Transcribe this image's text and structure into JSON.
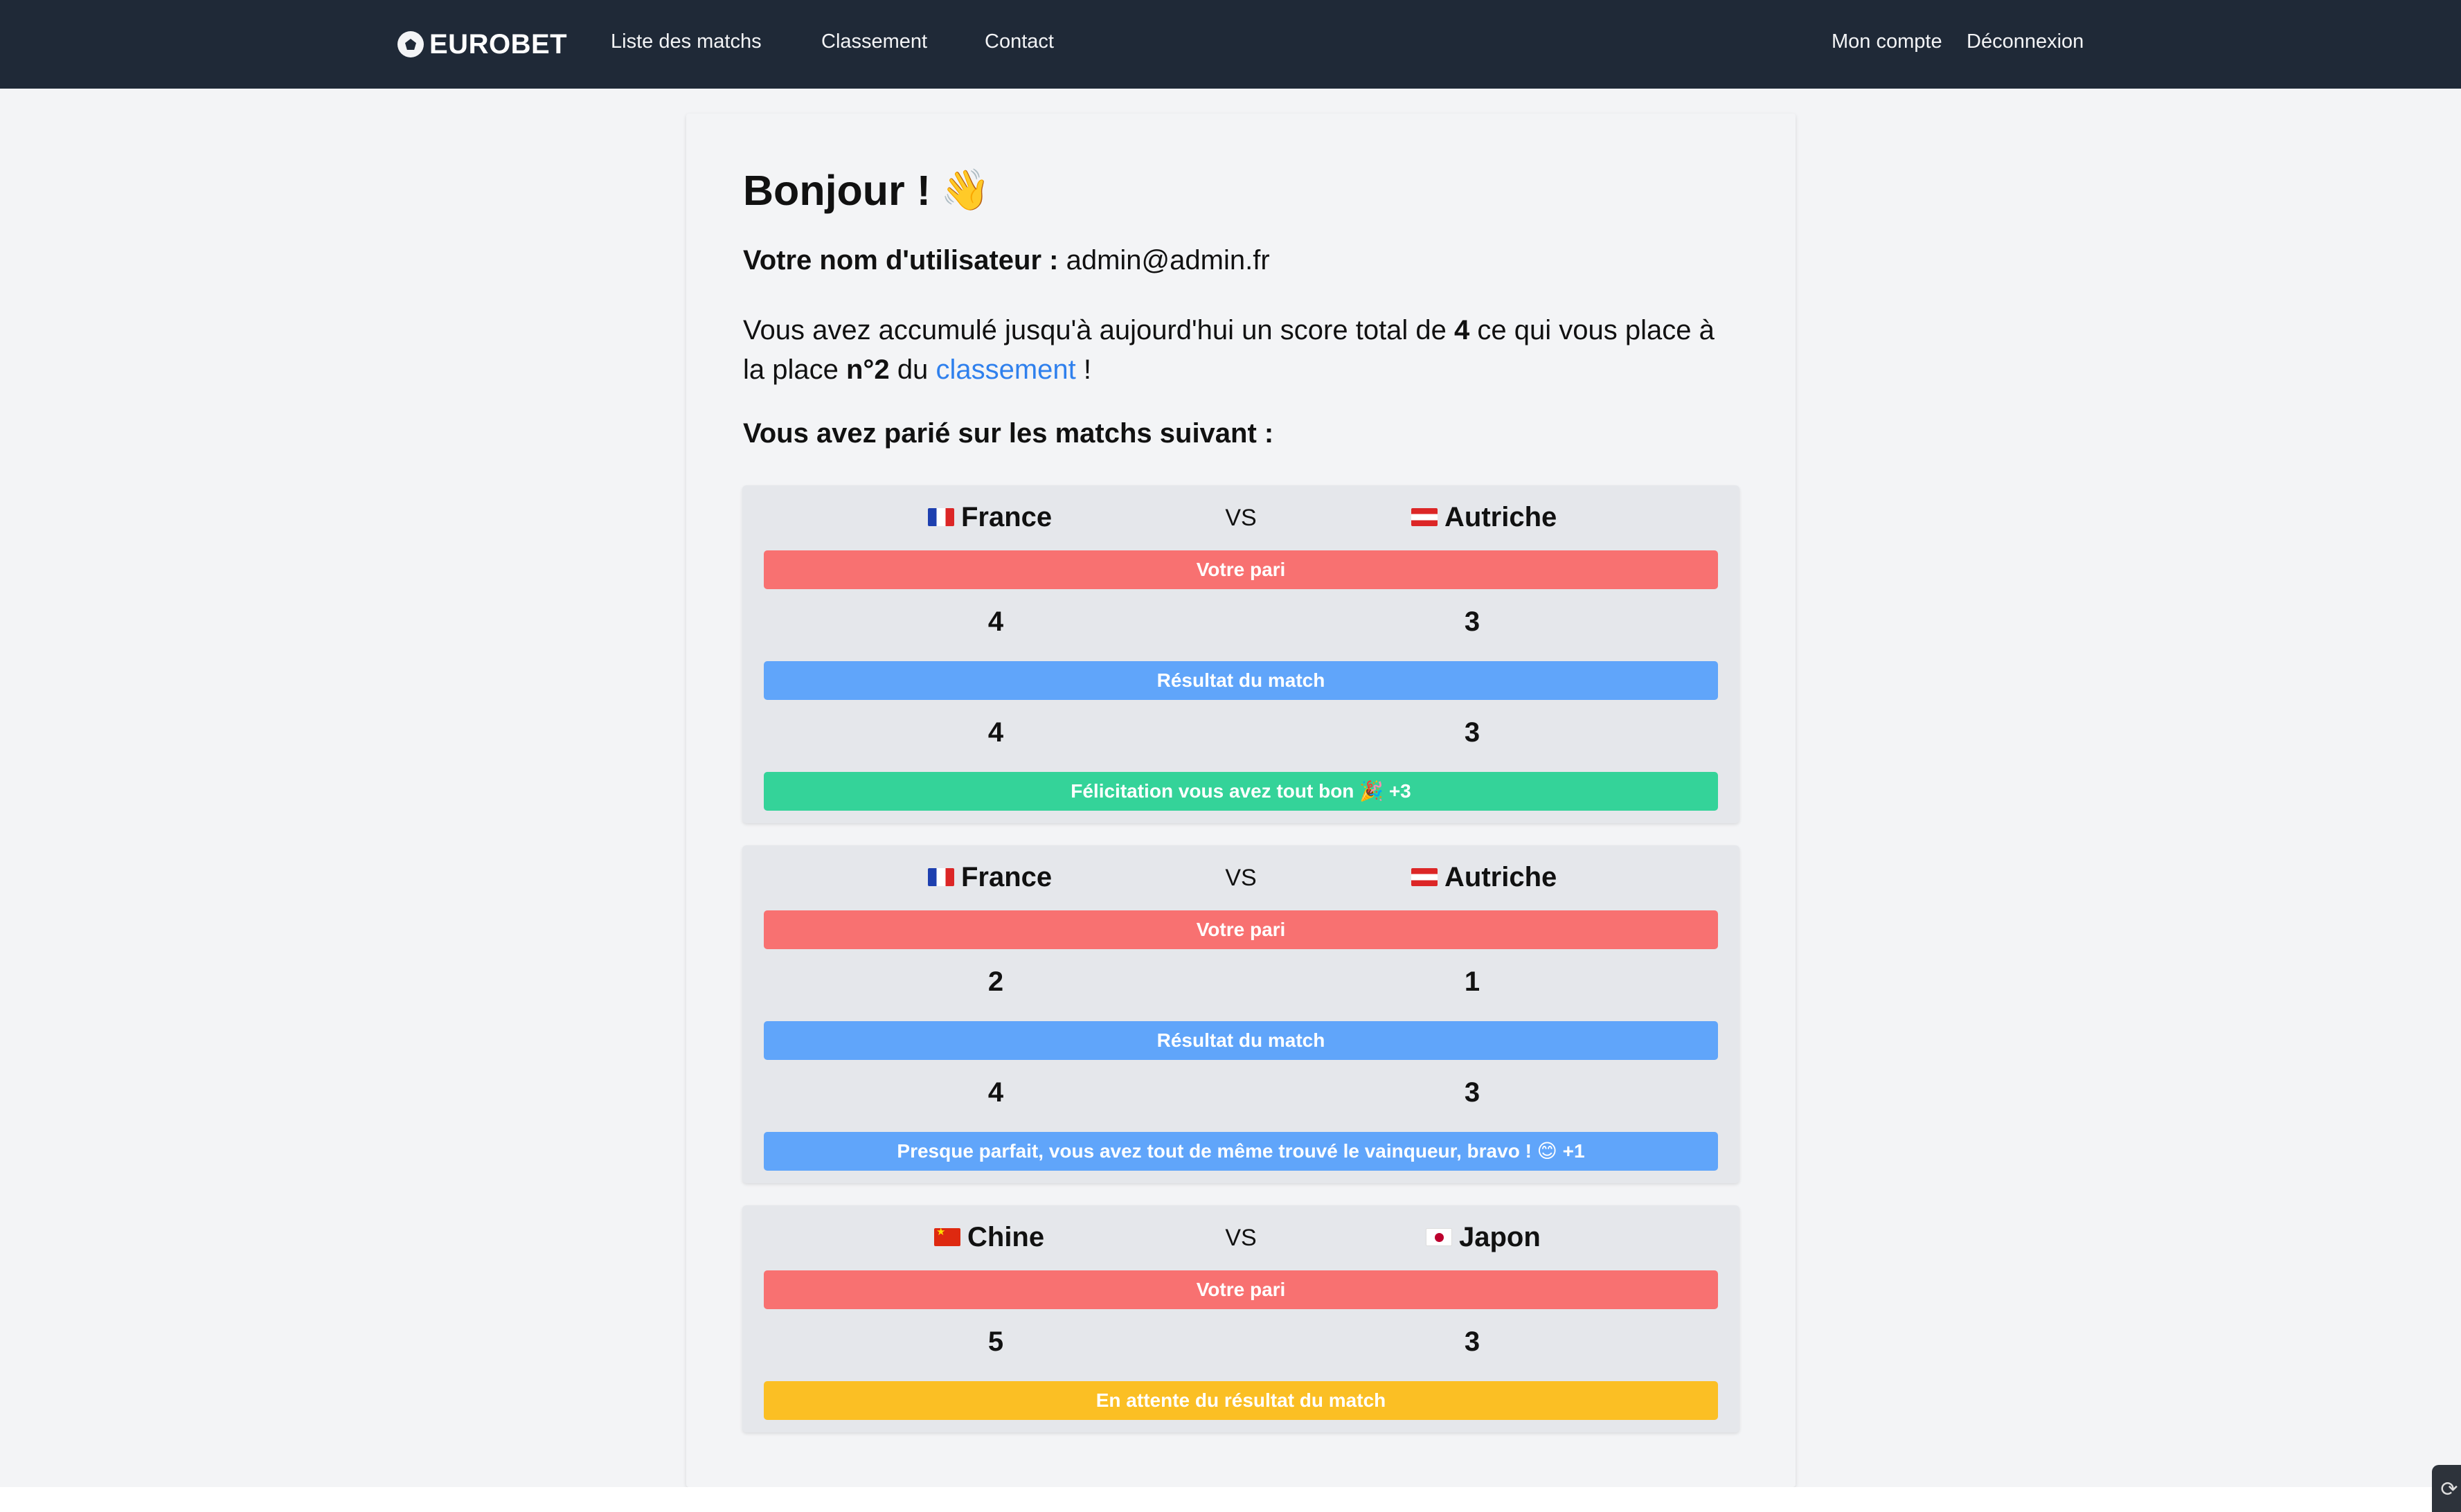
{
  "navbar": {
    "brand": "EUROBET",
    "links": [
      "Liste des matchs",
      "Classement",
      "Contact"
    ],
    "account": "Mon compte",
    "logout": "Déconnexion"
  },
  "profile": {
    "greeting": "Bonjour !",
    "greeting_emoji": "👋",
    "username_label": "Votre nom d'utilisateur :",
    "username": "admin@admin.fr",
    "score_prefix": "Vous avez accumulé jusqu'à aujourd'hui un score total de",
    "score": "4",
    "score_middle": "ce qui vous place à la place",
    "rank": "n°2",
    "rank_suffix_pre": "du",
    "ranking_link": "classement",
    "rank_suffix_post": "!",
    "bets_title": "Vous avez parié sur les matchs suivant :"
  },
  "matches": [
    {
      "team1": "France",
      "team1_flag": "flag-fr",
      "vs": "VS",
      "team2": "Autriche",
      "team2_flag": "flag-at",
      "bet_label": "Votre pari",
      "bet_score1": "4",
      "bet_score2": "3",
      "result_label": "Résultat du match",
      "result_score1": "4",
      "result_score2": "3",
      "status": "Félicitation vous avez tout bon 🎉 +3",
      "status_color": "#34d399"
    },
    {
      "team1": "France",
      "team1_flag": "flag-fr",
      "vs": "VS",
      "team2": "Autriche",
      "team2_flag": "flag-at",
      "bet_label": "Votre pari",
      "bet_score1": "2",
      "bet_score2": "1",
      "result_label": "Résultat du match",
      "result_score1": "4",
      "result_score2": "3",
      "status": "Presque parfait, vous avez tout de même trouvé le vainqueur, bravo ! 😊 +1",
      "status_color": "#60a5fa"
    },
    {
      "team1": "Chine",
      "team1_flag": "flag-cn",
      "vs": "VS",
      "team2": "Japon",
      "team2_flag": "flag-jp",
      "bet_label": "Votre pari",
      "bet_score1": "5",
      "bet_score2": "3",
      "status": "En attente du résultat du match",
      "status_color": "#fbbf24"
    }
  ],
  "colors": {
    "navbar_bg": "#1f2937",
    "bet_bar": "#f87171",
    "result_bar": "#60a5fa",
    "success": "#34d399",
    "pending": "#fbbf24",
    "link": "#2f80ed"
  }
}
